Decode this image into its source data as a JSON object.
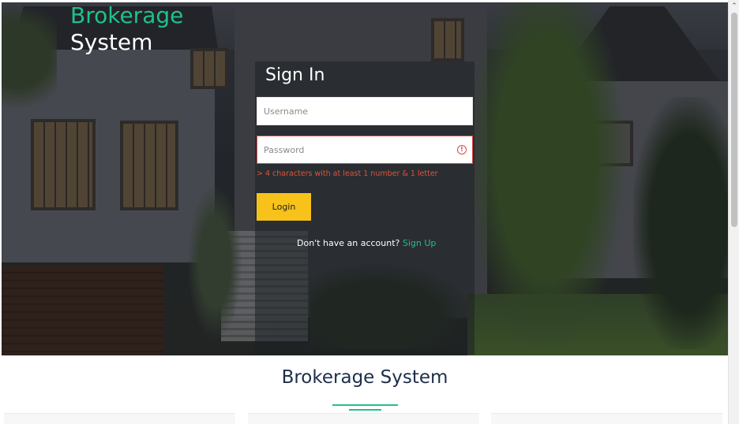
{
  "brand": {
    "line1": "Brokerage",
    "line2": "System",
    "accent_color": "#1ec28b"
  },
  "signin": {
    "title": "Sign In",
    "username_placeholder": "Username",
    "password_placeholder": "Password",
    "password_error_icon": "alert-circle-icon",
    "password_hint": "> 4 characters with at least 1 number & 1 letter",
    "login_label": "Login",
    "signup_prompt": "Don't have an account?",
    "signup_link": "Sign Up"
  },
  "section": {
    "title": "Brokerage System"
  },
  "scrollbar": {
    "up_icon": "chevron-up-icon"
  },
  "colors": {
    "login_button": "#f7c31a",
    "error": "#d94848",
    "heading": "#1d2e4a"
  }
}
